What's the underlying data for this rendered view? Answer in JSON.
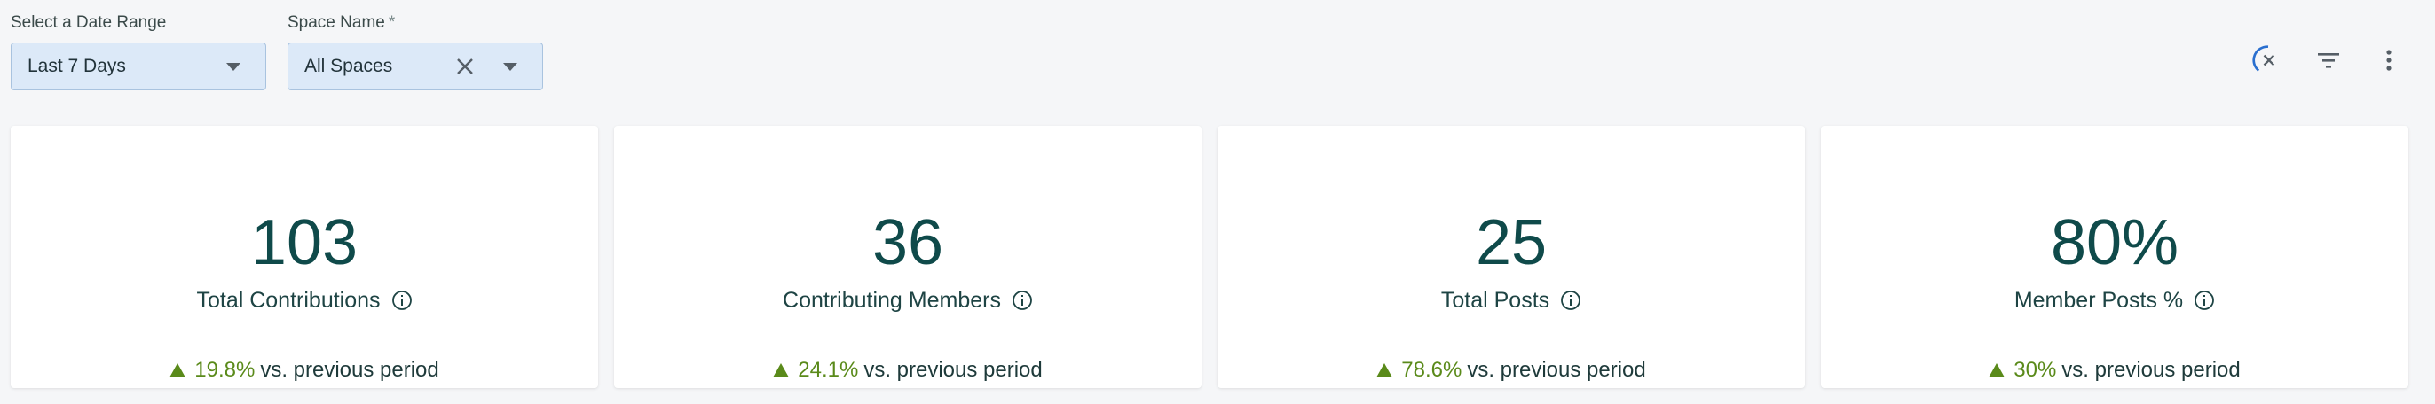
{
  "filters": {
    "date_range": {
      "label": "Select a Date Range",
      "value": "Last 7 Days"
    },
    "space_name": {
      "label": "Space Name",
      "required_mark": "*",
      "value": "All Spaces"
    }
  },
  "toolbar": {
    "icons": [
      "loading-cancel-icon",
      "filter-icon",
      "more-vert-icon"
    ]
  },
  "cards": [
    {
      "value": "103",
      "label": "Total Contributions",
      "change": "19.8%",
      "change_suffix": "vs. previous period"
    },
    {
      "value": "36",
      "label": "Contributing Members",
      "change": "24.1%",
      "change_suffix": "vs. previous period"
    },
    {
      "value": "25",
      "label": "Total Posts",
      "change": "78.6%",
      "change_suffix": "vs. previous period"
    },
    {
      "value": "80%",
      "label": "Member Posts %",
      "change": "30%",
      "change_suffix": "vs. previous period"
    }
  ],
  "colors": {
    "accent": "#0f4a4a",
    "positive": "#5a8a1a",
    "select_bg": "#dce9f8",
    "spinner": "#2a6fcf"
  }
}
